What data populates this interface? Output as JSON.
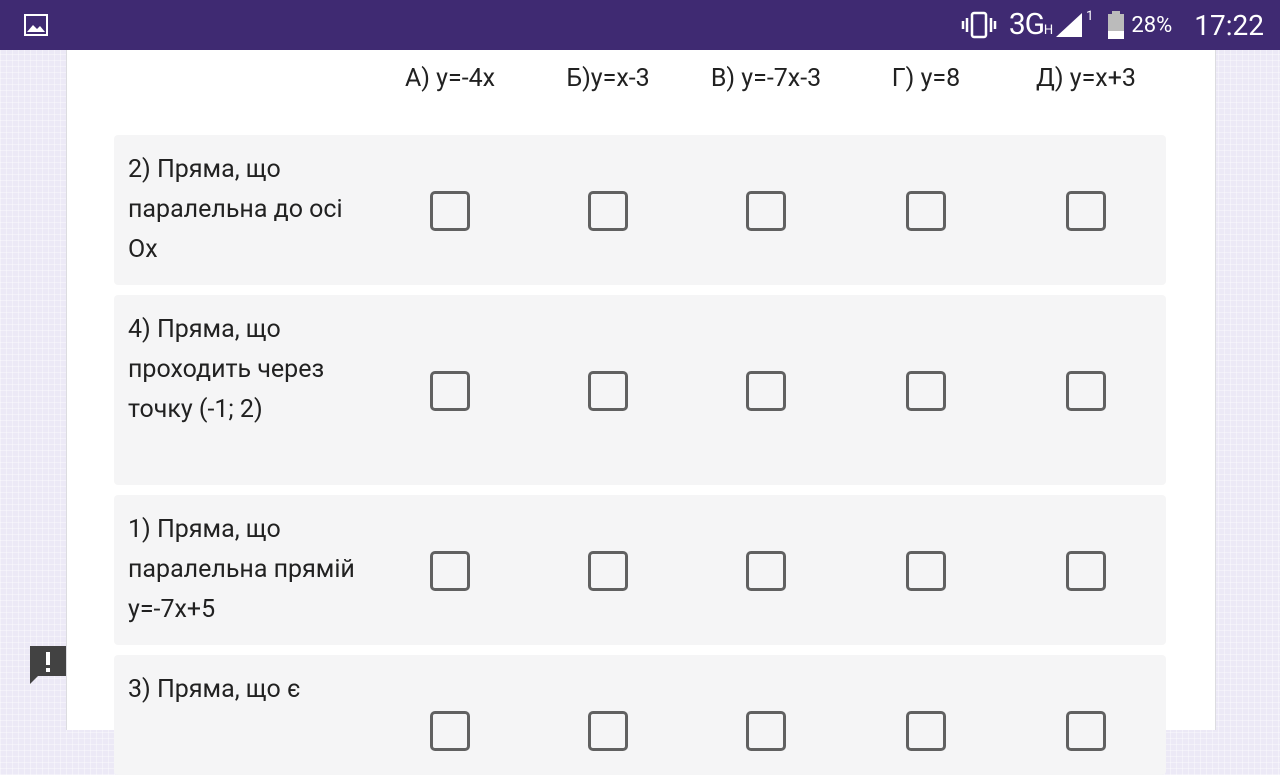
{
  "status_bar": {
    "network": "3G",
    "network_sub": "H",
    "sim": "1",
    "battery": "28%",
    "time": "17:22",
    "icons": [
      "gallery-icon",
      "vibrate-icon",
      "signal-icon",
      "battery-icon"
    ]
  },
  "grid": {
    "columns": [
      "А) y=-4x",
      "Б)y=x-3",
      "В) y=-7x-3",
      "Г) y=8",
      "Д) y=x+3"
    ],
    "rows": [
      {
        "label": "2) Пряма, що паралельна до осі Ох",
        "checked": [
          false,
          false,
          false,
          false,
          false
        ]
      },
      {
        "label": "4) Пряма, що проходить через точку (-1; 2)",
        "checked": [
          false,
          false,
          false,
          false,
          false
        ]
      },
      {
        "label": "1) Пряма, що паралельна прямій у=-7х+5",
        "checked": [
          false,
          false,
          false,
          false,
          false
        ]
      },
      {
        "label": "3) Пряма, що є",
        "checked": [
          false,
          false,
          false,
          false,
          false
        ]
      }
    ]
  },
  "colors": {
    "status_bar": "#3f2a72",
    "row_background": "#f5f5f6",
    "checkbox_border": "#616161"
  }
}
